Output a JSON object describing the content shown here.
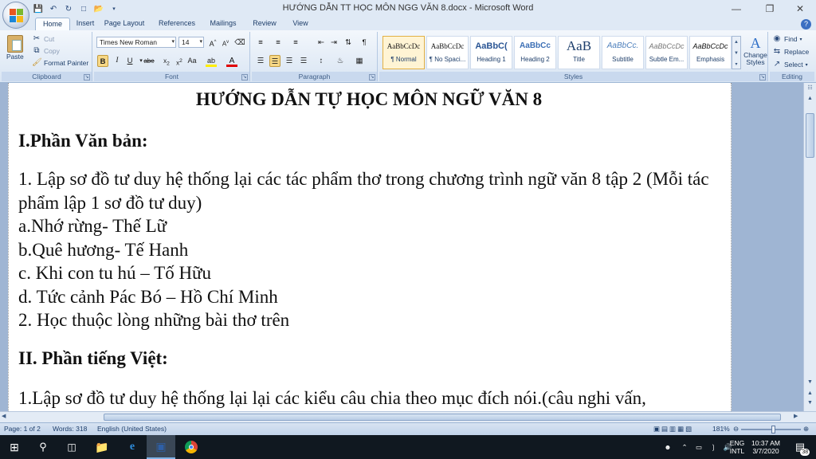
{
  "window": {
    "title": "HƯỚNG DẪN TT HỌC MÔN NGG VĂN 8.docx - Microsoft Word"
  },
  "tabs": [
    "Home",
    "Insert",
    "Page Layout",
    "References",
    "Mailings",
    "Review",
    "View"
  ],
  "ribbon": {
    "clipboard": {
      "paste": "Paste",
      "cut": "Cut",
      "copy": "Copy",
      "format_painter": "Format Painter",
      "label": "Clipboard"
    },
    "font": {
      "family": "Times New Roman",
      "size": "14",
      "label": "Font"
    },
    "paragraph": {
      "label": "Paragraph"
    },
    "styles": {
      "label": "Styles",
      "items": [
        {
          "preview": "AaBbCcDc",
          "name": "¶ Normal"
        },
        {
          "preview": "AaBbCcDc",
          "name": "¶ No Spaci..."
        },
        {
          "preview": "AaBbC(",
          "name": "Heading 1"
        },
        {
          "preview": "AaBbCc",
          "name": "Heading 2"
        },
        {
          "preview": "AaB",
          "name": "Title"
        },
        {
          "preview": "AaBbCc.",
          "name": "Subtitle"
        },
        {
          "preview": "AaBbCcDc",
          "name": "Subtle Em..."
        },
        {
          "preview": "AaBbCcDc",
          "name": "Emphasis"
        }
      ],
      "change_styles": "Change Styles"
    },
    "editing": {
      "find": "Find",
      "replace": "Replace",
      "select": "Select",
      "label": "Editing"
    }
  },
  "document": {
    "title": "HƯỚNG DẪN TỰ HỌC MÔN NGỮ VĂN 8",
    "h1": "I.Phần Văn bản:",
    "p1": "1. Lập sơ đồ tư duy hệ thống lại các tác phẩm thơ trong chương trình ngữ văn 8 tập 2 (Mỗi tác phẩm lập 1 sơ đồ tư duy)",
    "a": "a.Nhớ rừng- Thế Lữ",
    "b": "b.Quê hương- Tế Hanh",
    "c": "c. Khi con tu hú – Tố Hữu",
    "d": "d. Tức cảnh Pác Bó – Hồ Chí Minh",
    "p2": "2. Học thuộc lòng những bài thơ trên",
    "h2": "II. Phần tiếng Việt:",
    "p3": "1.Lập sơ đồ tư duy hệ thống lại lại các kiểu câu chia theo mục đích nói.(câu nghi vấn,"
  },
  "status": {
    "page": "Page: 1 of 2",
    "words": "Words: 318",
    "language": "English (United States)",
    "zoom": "181%"
  },
  "taskbar": {
    "lang": "ENG",
    "lang2": "INTL",
    "time": "10:37 AM",
    "date": "3/7/2020",
    "notifications": "38"
  }
}
